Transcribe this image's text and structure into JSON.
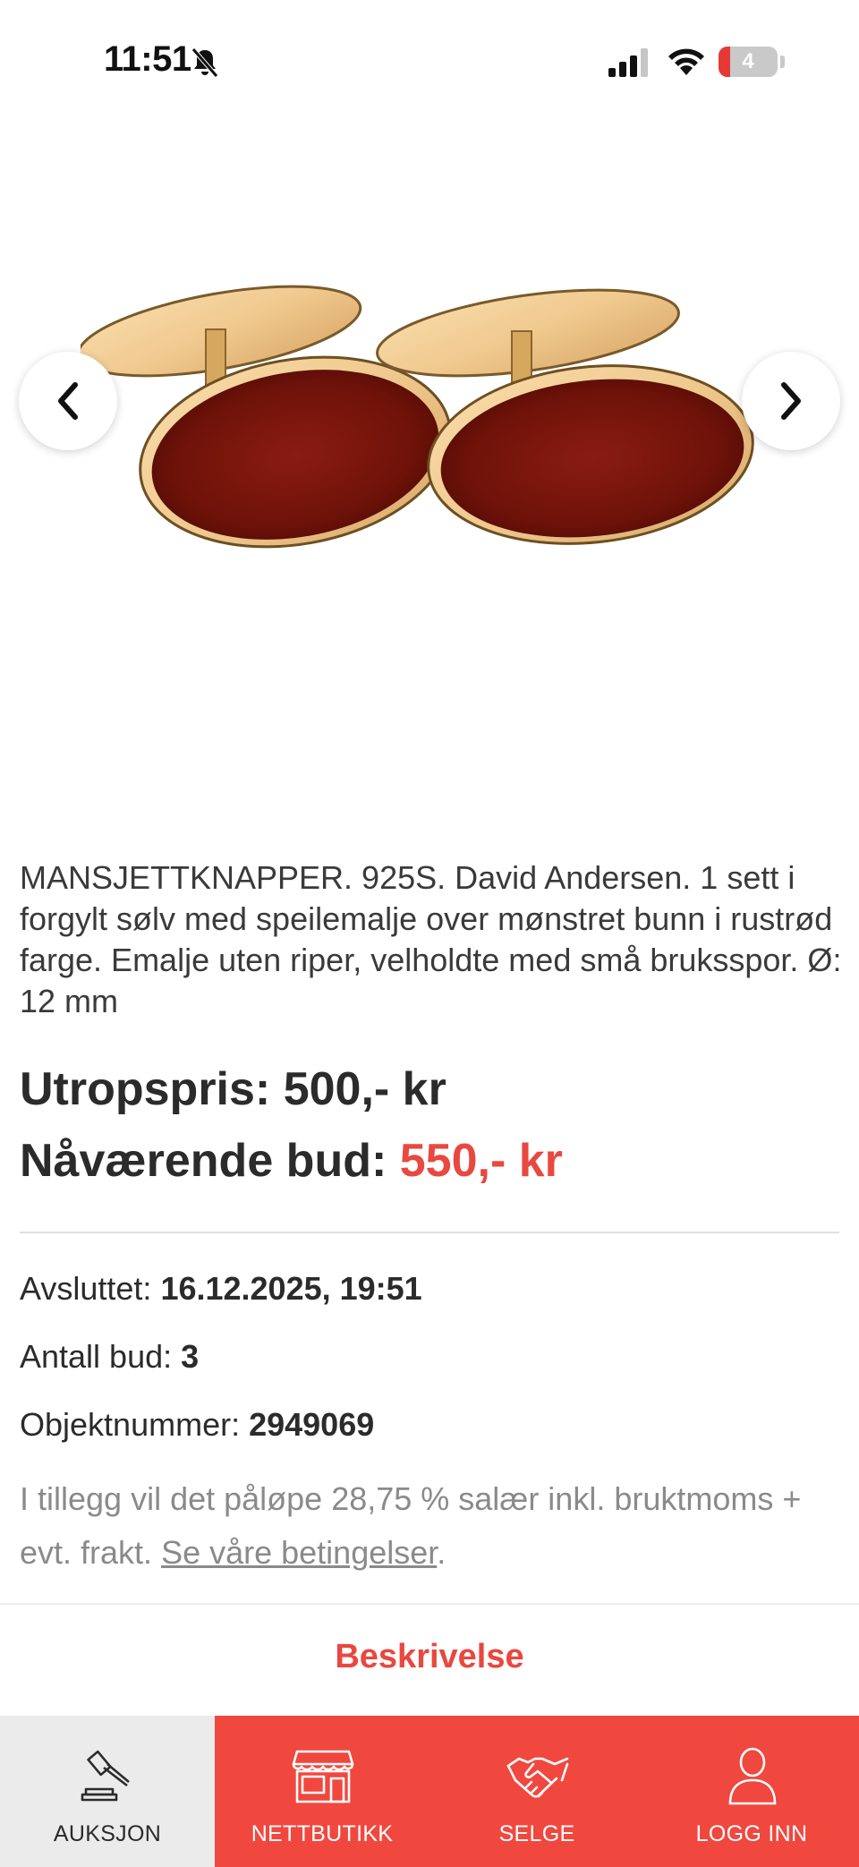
{
  "status_bar": {
    "time": "11:51",
    "battery_level": "4",
    "battery_fraction": 0.04,
    "accent_red": "#e8483f"
  },
  "gallery": {
    "image_alt": "cufflinks",
    "prev_icon": "chevron-left-icon",
    "next_icon": "chevron-right-icon"
  },
  "item": {
    "description": "MANSJETTKNAPPER. 925S. David Andersen. 1 sett i forgylt sølv med speilemalje over mønstret bunn i rustrød farge. Emalje uten riper, velholdte med små bruksspor. Ø: 12 mm",
    "start_price_label": "Utropspris:",
    "start_price_value": "500,- kr",
    "current_bid_label": "Nåværende bud:",
    "current_bid_value": "550,- kr",
    "ended_label": "Avsluttet:",
    "ended_value": "16.12.2025, 19:51",
    "bids_label": "Antall bud:",
    "bids_value": "3",
    "object_label": "Objektnummer:",
    "object_value": "2949069",
    "fee_text": "I tillegg vil det påløpe 28,75 % salær inkl. bruktmoms + evt. frakt.",
    "terms_link": "Se våre betingelser",
    "terms_suffix": "."
  },
  "tabs": {
    "description_label": "Beskrivelse"
  },
  "bottom_nav": [
    {
      "label": "AUKSJON",
      "icon": "gavel-icon",
      "active": true
    },
    {
      "label": "NETTBUTIKK",
      "icon": "store-icon",
      "active": false
    },
    {
      "label": "SELGE",
      "icon": "handshake-icon",
      "active": false
    },
    {
      "label": "LOGG INN",
      "icon": "user-icon",
      "active": false
    }
  ]
}
